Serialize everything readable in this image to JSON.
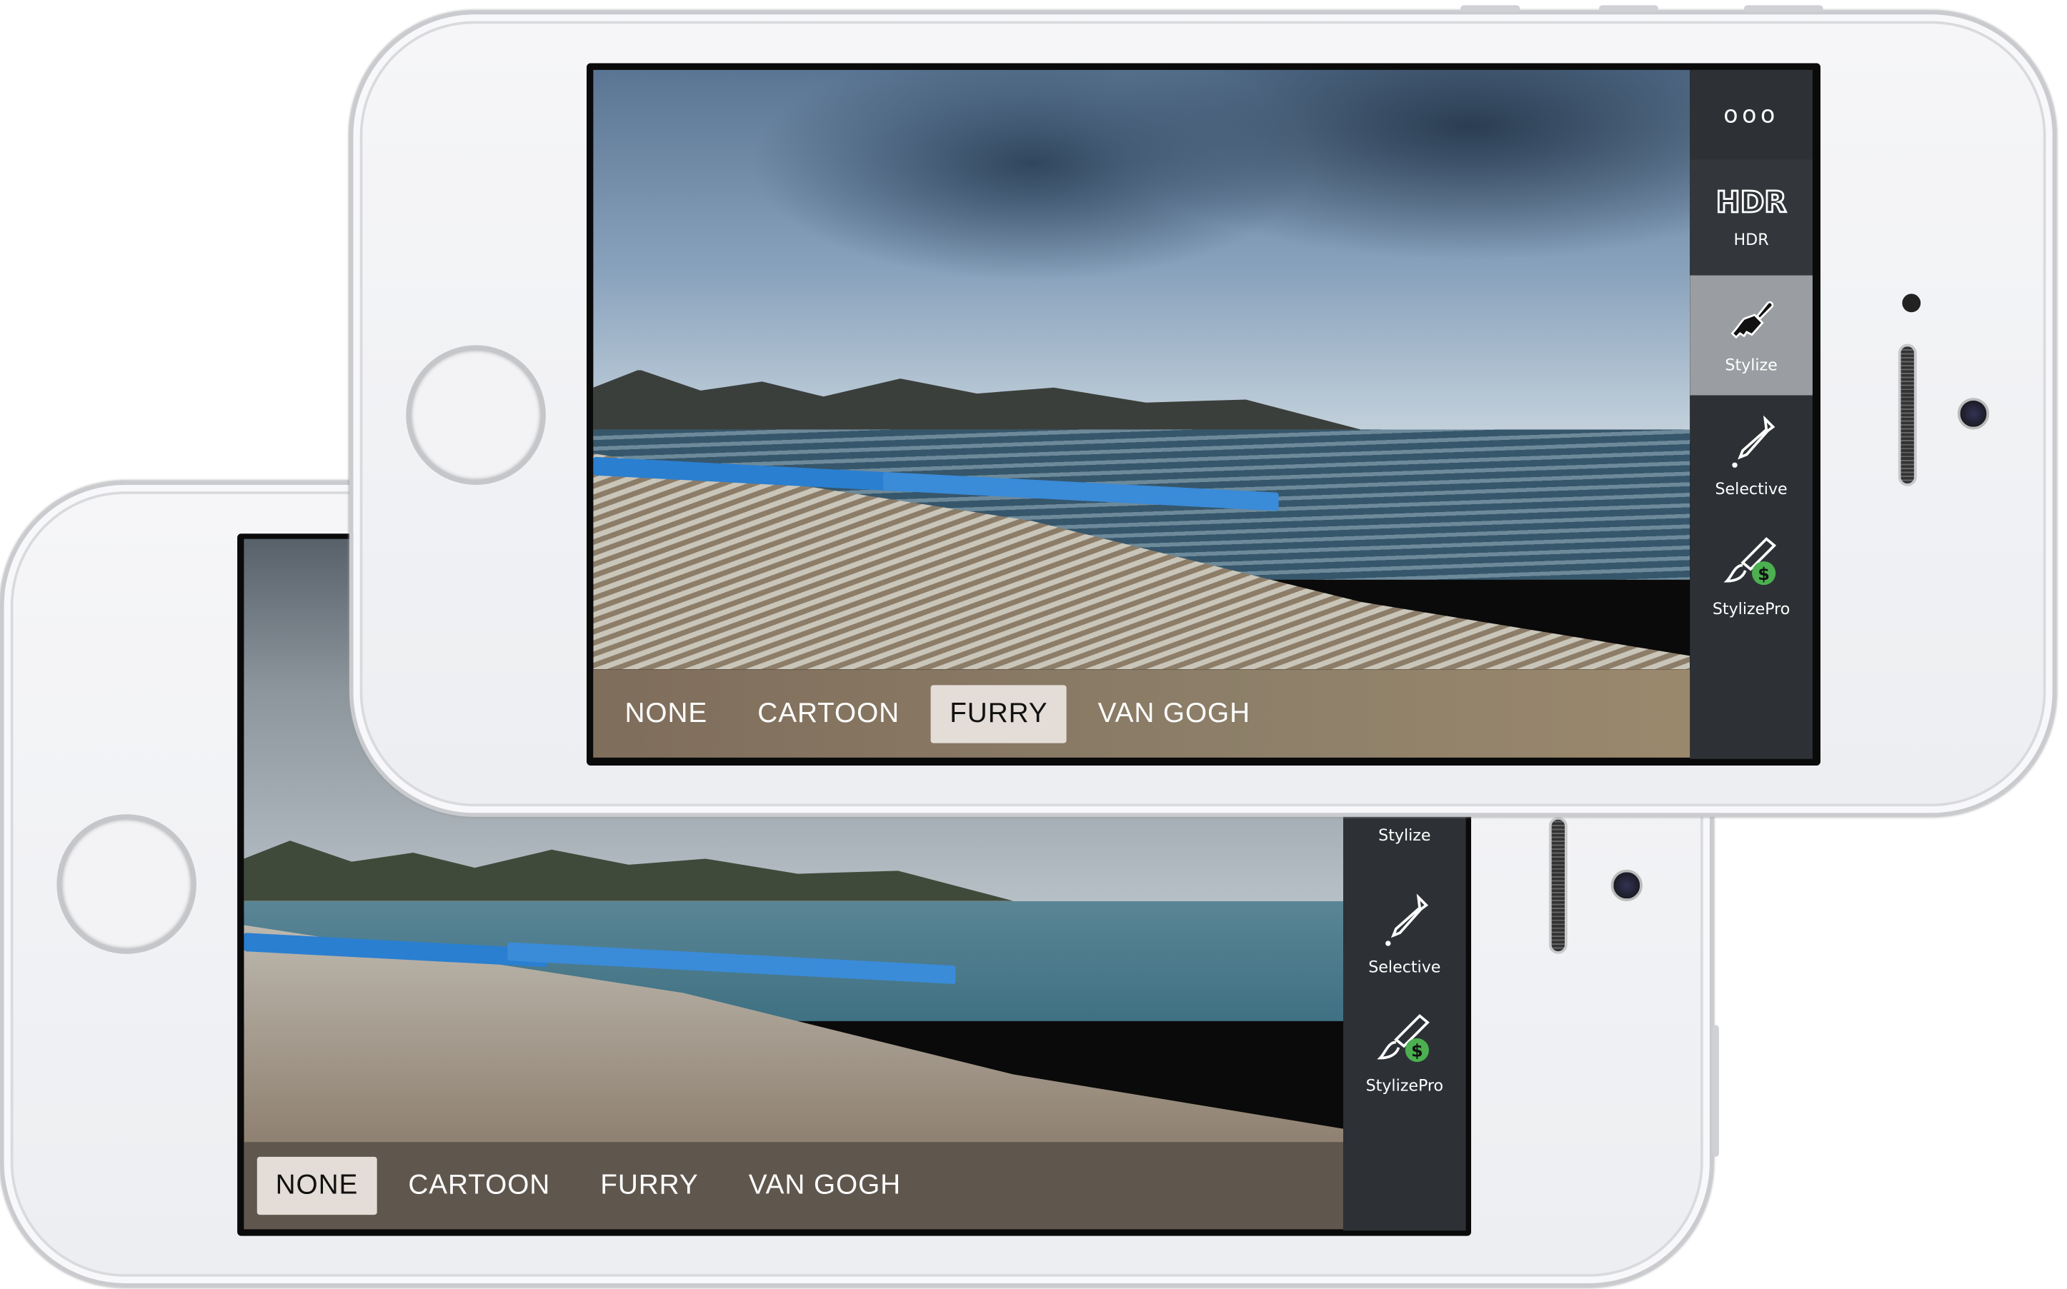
{
  "back_phone": {
    "filters": [
      {
        "label": "NONE",
        "selected": true
      },
      {
        "label": "CARTOON",
        "selected": false
      },
      {
        "label": "FURRY",
        "selected": false
      },
      {
        "label": "VAN GOGH",
        "selected": false
      }
    ],
    "sidebar": [
      {
        "label": "Stylize",
        "icon": "brush-icon"
      },
      {
        "label": "Selective",
        "icon": "eyedropper-icon"
      },
      {
        "label": "StylizePro",
        "icon": "pro-brush-icon"
      }
    ]
  },
  "front_phone": {
    "more_label": "ooo",
    "filters": [
      {
        "label": "NONE",
        "selected": false
      },
      {
        "label": "CARTOON",
        "selected": false
      },
      {
        "label": "FURRY",
        "selected": true
      },
      {
        "label": "VAN GOGH",
        "selected": false
      }
    ],
    "sidebar": [
      {
        "label": "HDR",
        "icon_text": "HDR",
        "icon": "hdr-icon",
        "selected": false
      },
      {
        "label": "Stylize",
        "icon": "brush-icon",
        "selected": true
      },
      {
        "label": "Selective",
        "icon": "eyedropper-icon",
        "selected": false
      },
      {
        "label": "StylizePro",
        "icon": "pro-brush-icon",
        "selected": false,
        "badge": "$"
      }
    ]
  },
  "colors": {
    "selected_chip": "#e4ddd7",
    "sidebar_bg": "#2d3136",
    "sidebar_selected": "#9a9da1",
    "pro_badge": "#4caf50",
    "umbrella": "#2a7fd0"
  }
}
